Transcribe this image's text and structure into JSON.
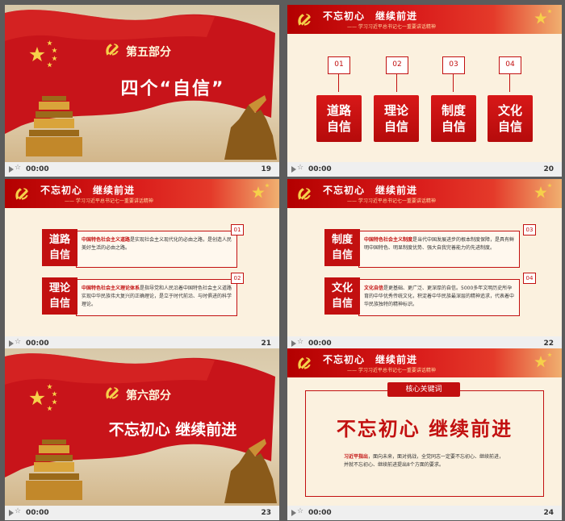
{
  "colors": {
    "party_red": "#c21010",
    "cream": "#fbf1df",
    "gold": "#f6d04a"
  },
  "slide_meta": {
    "time": "00:00"
  },
  "header": {
    "title": "不忘初心　继续前进",
    "subtitle": "—— 学习习近平总书记七一重要讲话精神"
  },
  "slides": [
    {
      "number": "19",
      "section": "第五部分",
      "title": "四个“自信”"
    },
    {
      "number": "20",
      "items": [
        {
          "num": "01",
          "line1": "道路",
          "line2": "自信"
        },
        {
          "num": "02",
          "line1": "理论",
          "line2": "自信"
        },
        {
          "num": "03",
          "line1": "制度",
          "line2": "自信"
        },
        {
          "num": "04",
          "line1": "文化",
          "line2": "自信"
        }
      ]
    },
    {
      "number": "21",
      "rows": [
        {
          "num": "01",
          "tag1": "道路",
          "tag2": "自信",
          "lead": "中国特色社会主义道路",
          "text": "是实现社会主义现代化的必由之路，是创造人民美好生活的必由之路。"
        },
        {
          "num": "02",
          "tag1": "理论",
          "tag2": "自信",
          "lead": "中国特色社会主义理论体系",
          "text": "是指导党和人民沿着中国特色社会主义道路实现中华民族伟大复兴的正确理论，是立于时代前沿、与时俱进的科学理论。"
        }
      ]
    },
    {
      "number": "22",
      "rows": [
        {
          "num": "03",
          "tag1": "制度",
          "tag2": "自信",
          "lead": "中国特色社会主义制度",
          "text": "是当代中国发展进步的根本制度保障，是具有鲜明中国特色、明显制度优势、强大自我完善能力的先进制度。"
        },
        {
          "num": "04",
          "tag1": "文化",
          "tag2": "自信",
          "lead": "文化自信",
          "text": "是更基础、更广泛、更深厚的自信。5000多年文明历史所孕育的中华优秀传统文化，积淀着中华民族最深层的精神追求，代表着中华民族独特的精神标识。"
        }
      ]
    },
    {
      "number": "23",
      "section": "第六部分",
      "title": "不忘初心  继续前进"
    },
    {
      "number": "24",
      "pill": "核心关键词",
      "big": "不忘初心  继续前进",
      "lead": "习近平指出",
      "text": "，面向未来，面对挑战，全党同志一定要不忘初心、继续前进，并就不忘初心、继续前进提出8个方面的要求。"
    }
  ]
}
